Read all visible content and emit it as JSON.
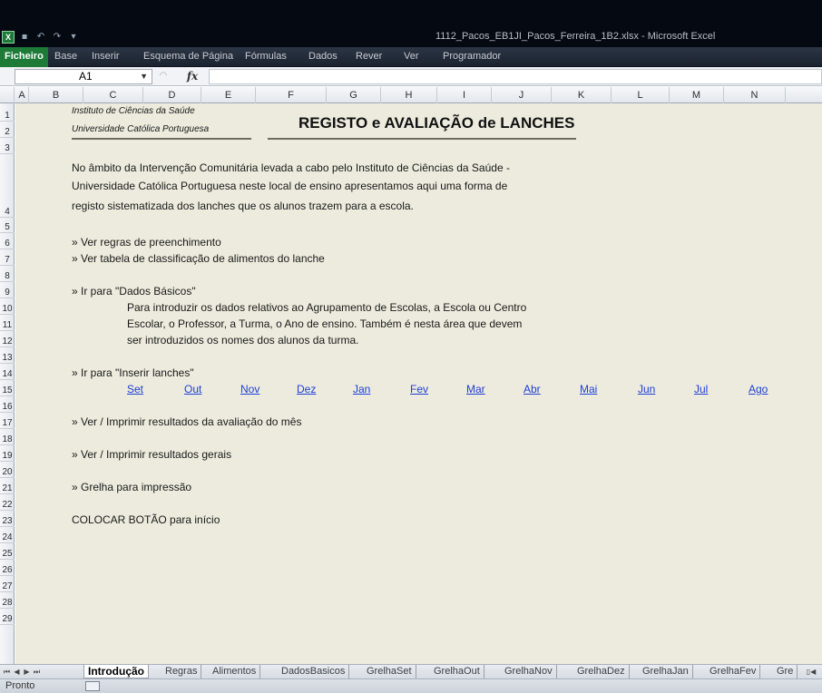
{
  "window": {
    "title": "1112_Pacos_EB1JI_Pacos_Ferreira_1B2.xlsx - Microsoft Excel",
    "app_icon": "excel-icon"
  },
  "ribbon": {
    "tabs": [
      "Ficheiro",
      "Base",
      "Inserir",
      "Esquema de Página",
      "Fórmulas",
      "Dados",
      "Rever",
      "Ver",
      "Programador"
    ]
  },
  "formula_bar": {
    "name_box": "A1",
    "fx_label": "fx",
    "formula": ""
  },
  "columns": [
    "A",
    "B",
    "C",
    "D",
    "E",
    "F",
    "G",
    "H",
    "I",
    "J",
    "K",
    "L",
    "M",
    "N"
  ],
  "rows": [
    "1",
    "2",
    "3",
    "4",
    "5",
    "6",
    "7",
    "8",
    "9",
    "10",
    "11",
    "12",
    "13",
    "14",
    "15",
    "16",
    "17",
    "18",
    "19",
    "20",
    "21",
    "22",
    "23",
    "24",
    "25",
    "26",
    "27",
    "28",
    "29"
  ],
  "sheet": {
    "institute_line1": "Instituto de Ciências da Saúde",
    "institute_line2": "Universidade Católica Portuguesa",
    "title": "REGISTO e AVALIAÇÃO de LANCHES",
    "intro": [
      "No âmbito da Intervenção Comunitária levada a cabo pelo Instituto de Ciências da Saúde -",
      "Universidade Católica Portuguesa neste local de ensino apresentamos aqui uma forma de",
      "registo sistematizada dos lanches que os alunos trazem para a escola."
    ],
    "link_rules": "» Ver regras de preenchimento",
    "link_foods": "» Ver tabela de classificação de alimentos do lanche",
    "link_basic": "» Ir para \"Dados Básicos\"",
    "basic_desc": [
      "Para introduzir os dados relativos ao Agrupamento de Escolas, a Escola ou Centro",
      "Escolar, o Professor, a Turma, o Ano de ensino. Também é nesta área que devem",
      "ser introduzidos os nomes dos alunos da turma."
    ],
    "link_insert": "» Ir para \"Inserir lanches\"",
    "months": [
      "Set",
      "Out",
      "Nov",
      "Dez",
      "Jan",
      "Fev",
      "Mar",
      "Abr",
      "Mai",
      "Jun",
      "Jul",
      "Ago"
    ],
    "link_month_results": "» Ver / Imprimir resultados da avaliação do mês",
    "link_general_results": "» Ver / Imprimir resultados gerais",
    "link_grid": "» Grelha para impressão",
    "note_button": "COLOCAR BOTÃO para início"
  },
  "sheet_tabs": [
    "Introdução",
    "Regras",
    "Alimentos",
    "DadosBasicos",
    "GrelhaSet",
    "GrelhaOut",
    "GrelhaNov",
    "GrelhaDez",
    "GrelhaJan",
    "GrelhaFev",
    "Gre"
  ],
  "status": {
    "ready": "Pronto"
  }
}
